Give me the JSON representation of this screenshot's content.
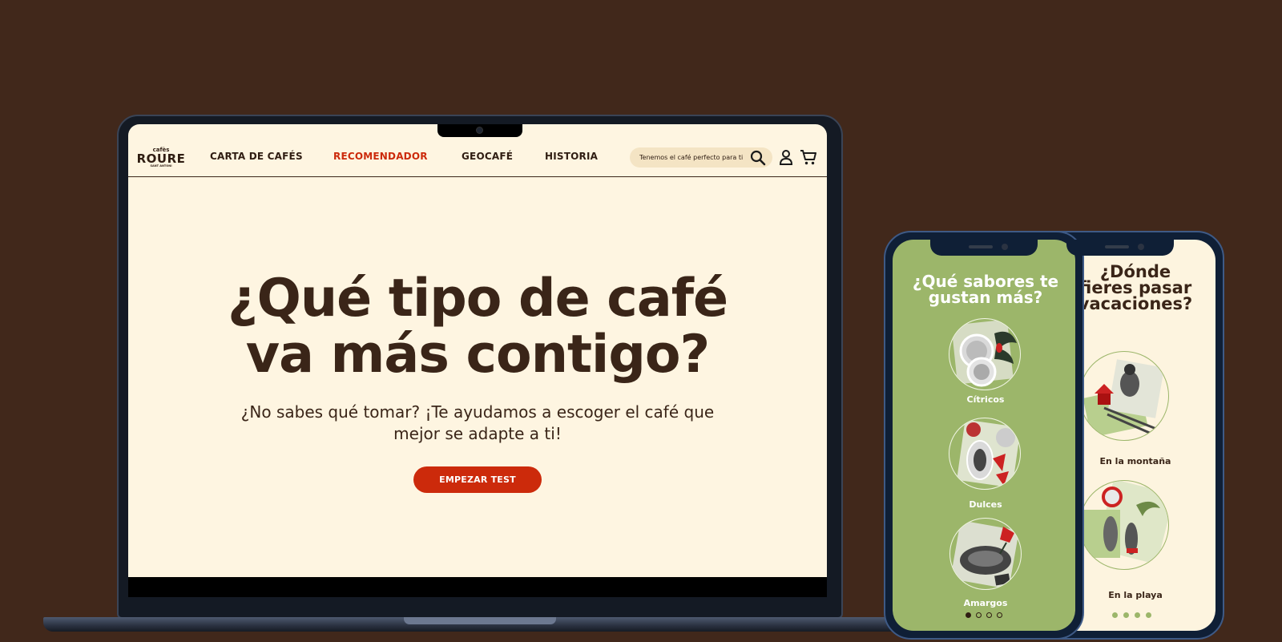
{
  "laptop": {
    "logo": {
      "small": "cafès",
      "big": "ROURE",
      "tiny": "SANT ANTONI"
    },
    "nav": [
      {
        "label": "CARTA DE CAFÉS",
        "active": false
      },
      {
        "label": "RECOMENDADOR",
        "active": true
      },
      {
        "label": "GEOCAFÉ",
        "active": false
      },
      {
        "label": "HISTORIA",
        "active": false
      }
    ],
    "search": {
      "placeholder": "Tenemos el café perfecto para ti"
    },
    "icons": [
      "search-icon",
      "user-icon",
      "cart-icon"
    ],
    "hero": {
      "title_line1": "¿Qué tipo de café",
      "title_line2": "va más contigo?",
      "subtitle_line1": "¿No sabes qué tomar? ¡Te ayudamos a escoger el café que",
      "subtitle_line2": "mejor se adapte a ti!",
      "cta": "EMPEZAR TEST"
    }
  },
  "phone_flavors": {
    "title_line1": "¿Qué sabores te",
    "title_line2": "gustan más?",
    "options": [
      "Cítricos",
      "Dulces",
      "Amargos"
    ],
    "pagination": {
      "total": 4,
      "current": 1
    }
  },
  "phone_vacation": {
    "title_line1": "¿Dónde",
    "title_line2": "fieres pasar",
    "title_line3": "vacaciones?",
    "options": [
      "En la montaña",
      "En la playa"
    ],
    "pagination": {
      "total": 4
    }
  },
  "colors": {
    "background": "#41281b",
    "cream": "#fef5e1",
    "brown": "#3a2518",
    "accent_red": "#cc2a0b",
    "green": "#9cb66a"
  }
}
